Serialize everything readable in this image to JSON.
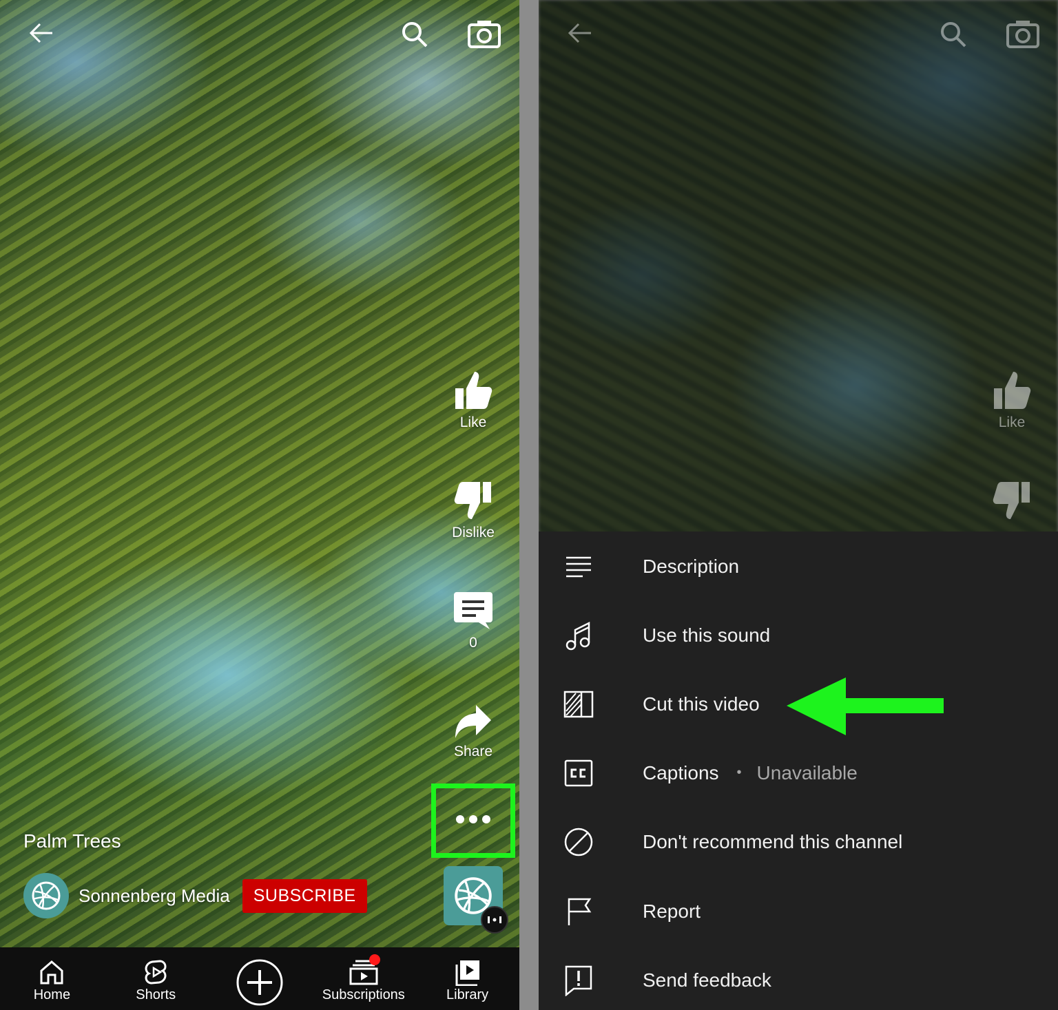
{
  "left": {
    "video_title": "Palm Trees",
    "channel_name": "Sonnenberg Media",
    "subscribe_label": "SUBSCRIBE",
    "actions": {
      "like": "Like",
      "dislike": "Dislike",
      "comments_count": "0",
      "share": "Share"
    },
    "nav": {
      "home": "Home",
      "shorts": "Shorts",
      "subscriptions": "Subscriptions",
      "library": "Library"
    },
    "highlight_color": "#1df31d",
    "subscribe_color": "#cc0000"
  },
  "right": {
    "like_label": "Like",
    "menu": {
      "description": "Description",
      "use_sound": "Use this sound",
      "cut_video": "Cut this video",
      "captions": "Captions",
      "captions_status": "Unavailable",
      "dont_recommend": "Don't recommend this channel",
      "report": "Report",
      "send_feedback": "Send feedback"
    },
    "arrow_color": "#1df31d",
    "sheet_color": "#212121"
  }
}
